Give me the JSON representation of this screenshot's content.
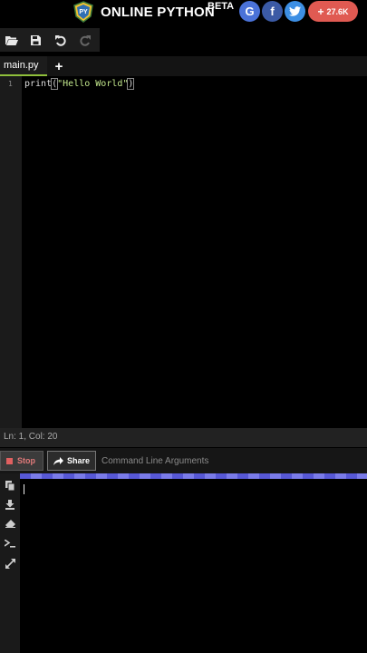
{
  "header": {
    "logo_text": "PY",
    "title": "ONLINE PYTHON",
    "badge": "BETA",
    "social": {
      "google": "G",
      "facebook": "f",
      "share_count": "27.6K"
    },
    "colors": {
      "google": "#4a72d8",
      "facebook": "#3b5aa5",
      "twitter": "#3d8fe4",
      "share": "#e05a52"
    }
  },
  "toolbar": {
    "icons": [
      "folder-open-icon",
      "save-icon",
      "undo-icon",
      "redo-icon"
    ]
  },
  "tabs": {
    "active": "main.py",
    "add_symbol": "+"
  },
  "editor": {
    "line_numbers": [
      "1"
    ],
    "code": {
      "fn": "print",
      "open": "(",
      "string": "\"Hello World\"",
      "close": ")"
    }
  },
  "status": {
    "text": "Ln: 1,  Col: 20"
  },
  "run": {
    "stop_label": "Stop",
    "share_label": "Share",
    "args_placeholder": "Command Line Arguments"
  },
  "terminal": {
    "side_icons": [
      "copy-icon",
      "download-icon",
      "eraser-icon",
      "prompt-icon",
      "expand-icon"
    ]
  },
  "colors": {
    "accent_green": "#8fbf3b",
    "progress": "#5758d6",
    "stop_red": "#e06060"
  }
}
